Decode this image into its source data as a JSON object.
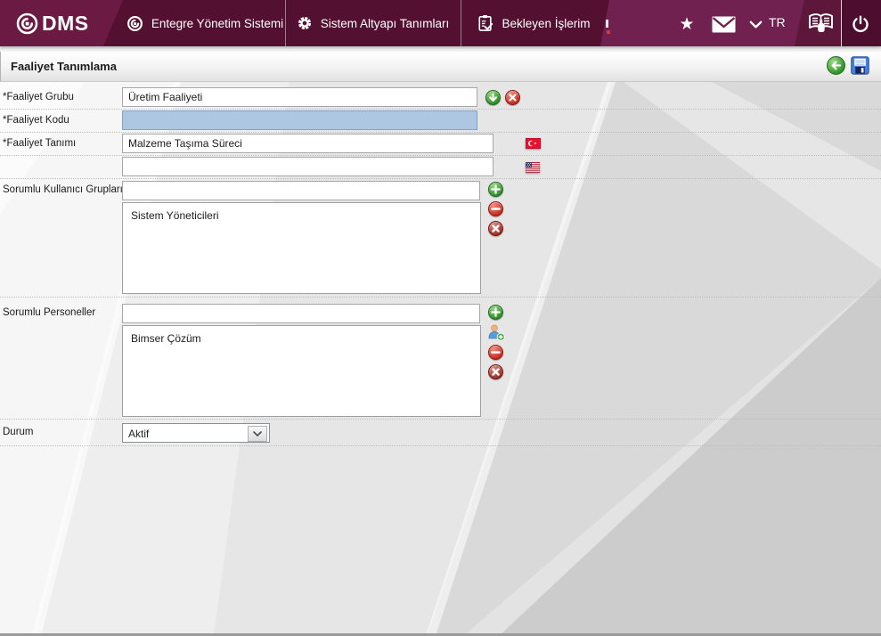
{
  "topbar": {
    "logo_text": "DMS",
    "logo_icon": "qdms-spiral-icon",
    "menu": [
      {
        "icon": "qdms-circle-icon",
        "label": "Entegre Yönetim Sistemi"
      },
      {
        "icon": "gear-icon",
        "label": "Sistem Altyapı Tanımları"
      },
      {
        "icon": "clipboard-check-icon",
        "label": "Bekleyen İşlerim"
      }
    ],
    "language": "TR",
    "icons": {
      "favorites": "star-icon",
      "messages": "mail-icon",
      "language_dropdown": "chevron-down-icon",
      "help": "book-hand-icon",
      "logout": "power-icon"
    }
  },
  "toolbar": {
    "back_icon": "back-arrow-icon",
    "save_icon": "save-disk-icon"
  },
  "page": {
    "title": "Faaliyet Tanımlama"
  },
  "form": {
    "faaliyet_grubu": {
      "label": "*Faaliyet Grubu",
      "value": "Üretim Faaliyeti",
      "buttons": [
        "select-down-icon",
        "clear-icon"
      ]
    },
    "faaliyet_kodu": {
      "label": "*Faaliyet Kodu",
      "value": "",
      "state": "focused"
    },
    "faaliyet_tanimi": {
      "label": "*Faaliyet Tanımı",
      "value_tr": "Malzeme Taşıma Süreci",
      "value_en": "",
      "flags": [
        "flag-turkey-icon",
        "flag-usa-icon"
      ]
    },
    "sorumlu_kullanici_gruplari": {
      "label": "Sorumlu Kullanıcı Grupları",
      "input_value": "",
      "items": [
        "Sistem Yöneticileri"
      ],
      "buttons": [
        "add-icon",
        "remove-icon",
        "clear-icon"
      ]
    },
    "sorumlu_personeller": {
      "label": "Sorumlu Personeller",
      "input_value": "",
      "items": [
        "Bimser Çözüm"
      ],
      "buttons": [
        "add-icon",
        "add-person-icon",
        "remove-icon",
        "clear-icon"
      ]
    },
    "durum": {
      "label": "Durum",
      "value": "Aktif"
    }
  },
  "colors": {
    "topbar_dark": "#541031",
    "topbar_mid": "#702150",
    "topbar_logo": "#6b1a43",
    "topbar_icon_tile": "#4c0d2f",
    "focused_field": "#adc6e2",
    "button_green": "#2e8c27",
    "button_red": "#c9271b",
    "button_dark_red": "#9c2920",
    "save_blue": "#4d7fd6"
  }
}
